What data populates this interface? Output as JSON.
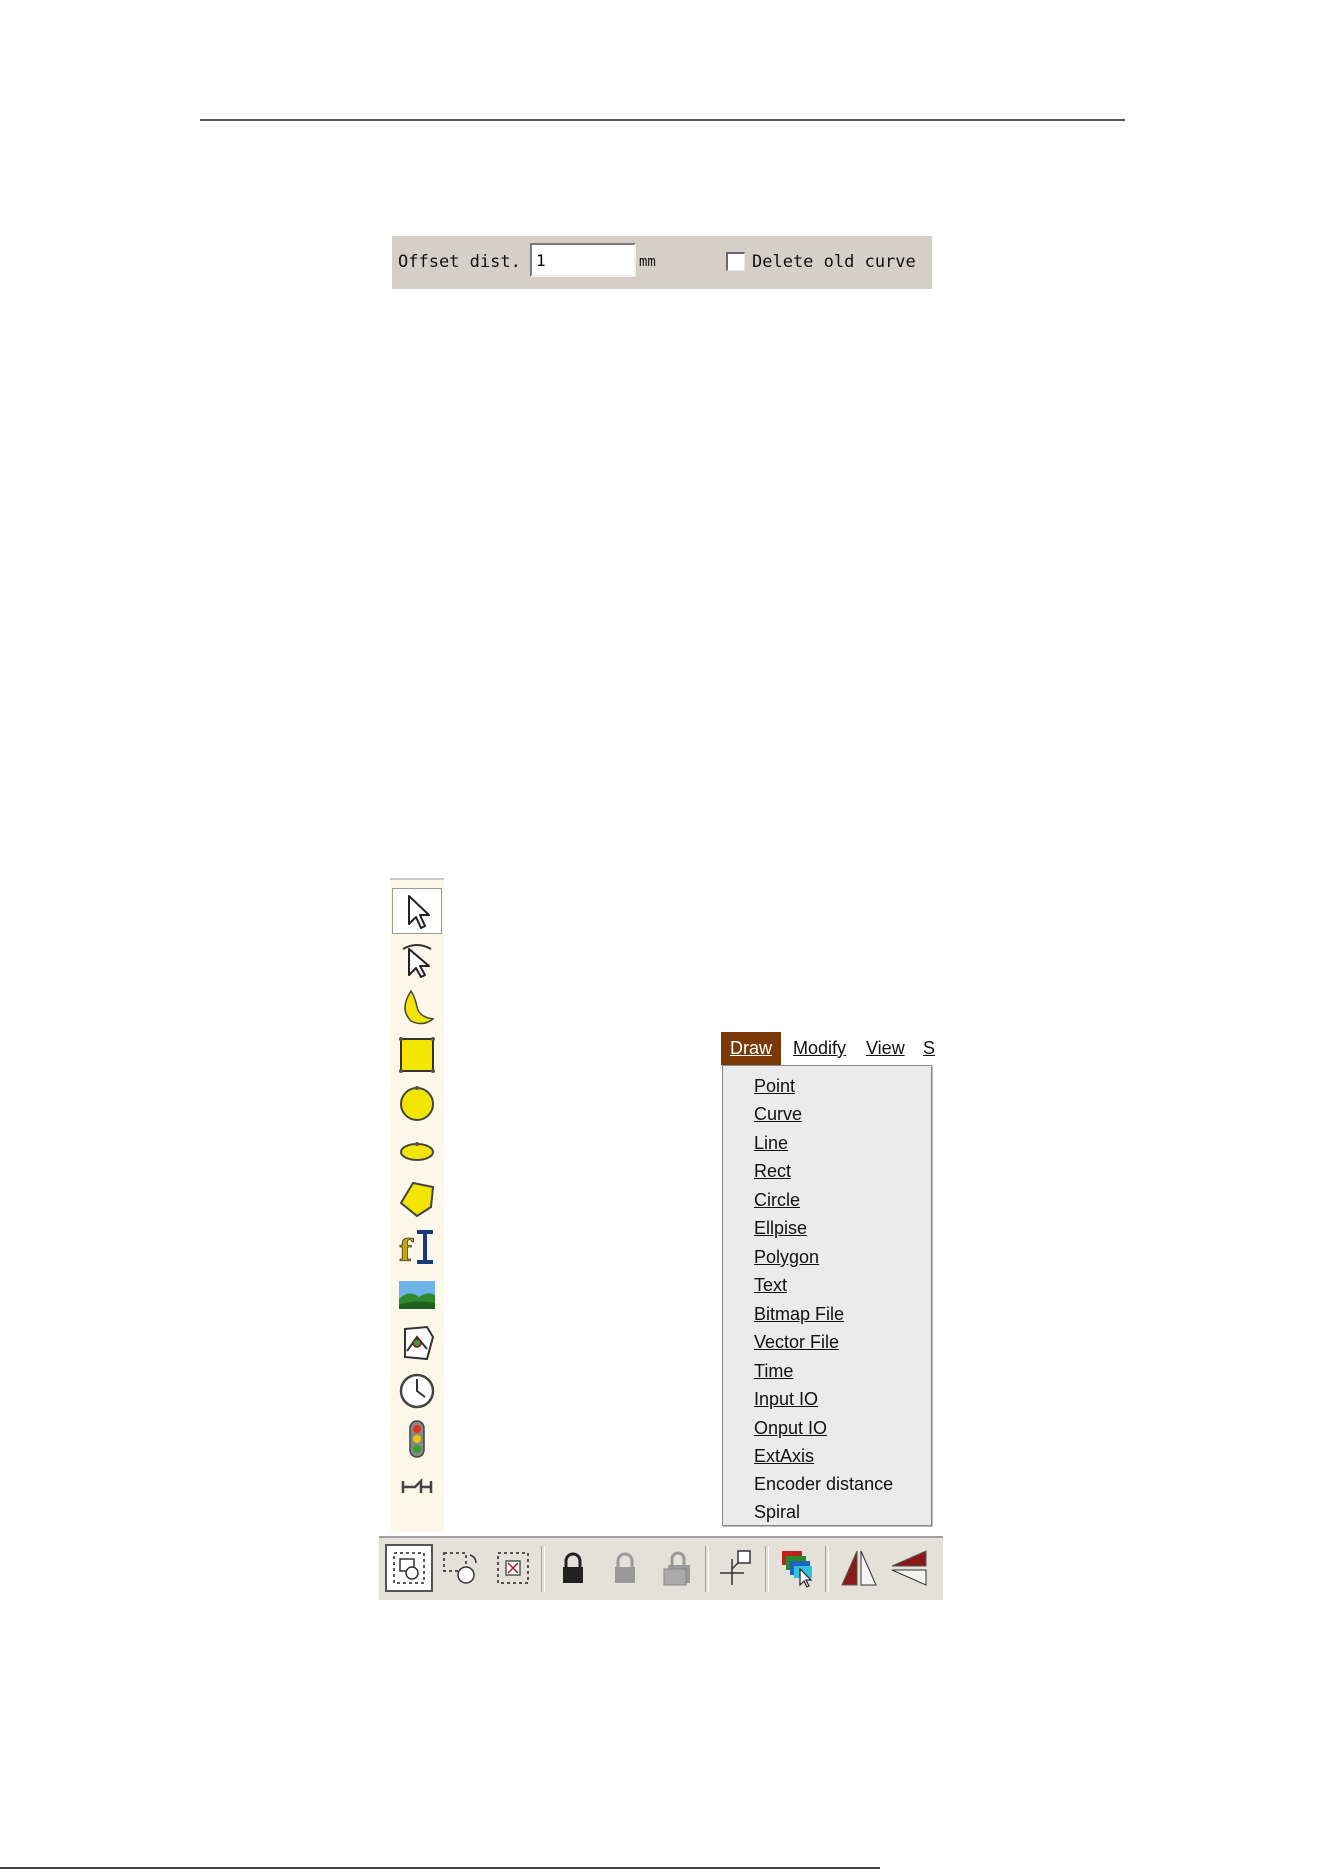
{
  "offset_bar": {
    "label": "Offset dist.",
    "value": "1",
    "unit": "mm",
    "checkbox_label": "Delete old curve",
    "checkbox_checked": false
  },
  "menubar": {
    "items": [
      "Draw",
      "Modify",
      "View",
      "S"
    ],
    "active": "Draw"
  },
  "draw_menu": {
    "items": [
      "Point",
      "Curve",
      "Line",
      "Rect",
      "Circle",
      "Ellpise",
      "Polygon",
      "Text",
      "Bitmap File",
      "Vector File",
      "Time",
      "Input IO",
      "Onput IO",
      "ExtAxis",
      "Encoder distance",
      "Spiral"
    ]
  },
  "vertical_toolbar": {
    "tools": [
      "select-arrow-icon",
      "node-edit-icon",
      "curve-icon",
      "rectangle-icon",
      "circle-icon",
      "ellipse-icon",
      "polygon-icon",
      "text-icon",
      "bitmap-icon",
      "vector-file-icon",
      "time-icon",
      "input-io-icon",
      "ext-axis-icon"
    ]
  },
  "bottom_toolbar": {
    "tools": [
      "select-all-icon",
      "select-rotate-icon",
      "select-cancel-icon",
      "lock-icon",
      "unlock-icon",
      "unlock-all-icon",
      "position-icon",
      "color-layer-icon",
      "mirror-horizontal-icon",
      "mirror-vertical-icon"
    ]
  },
  "colors": {
    "panel_gray": "#d4d0c8",
    "menu_active": "#7a3a08",
    "toolbar_cream": "#fbf8ea",
    "shape_yellow": "#f2e600"
  }
}
